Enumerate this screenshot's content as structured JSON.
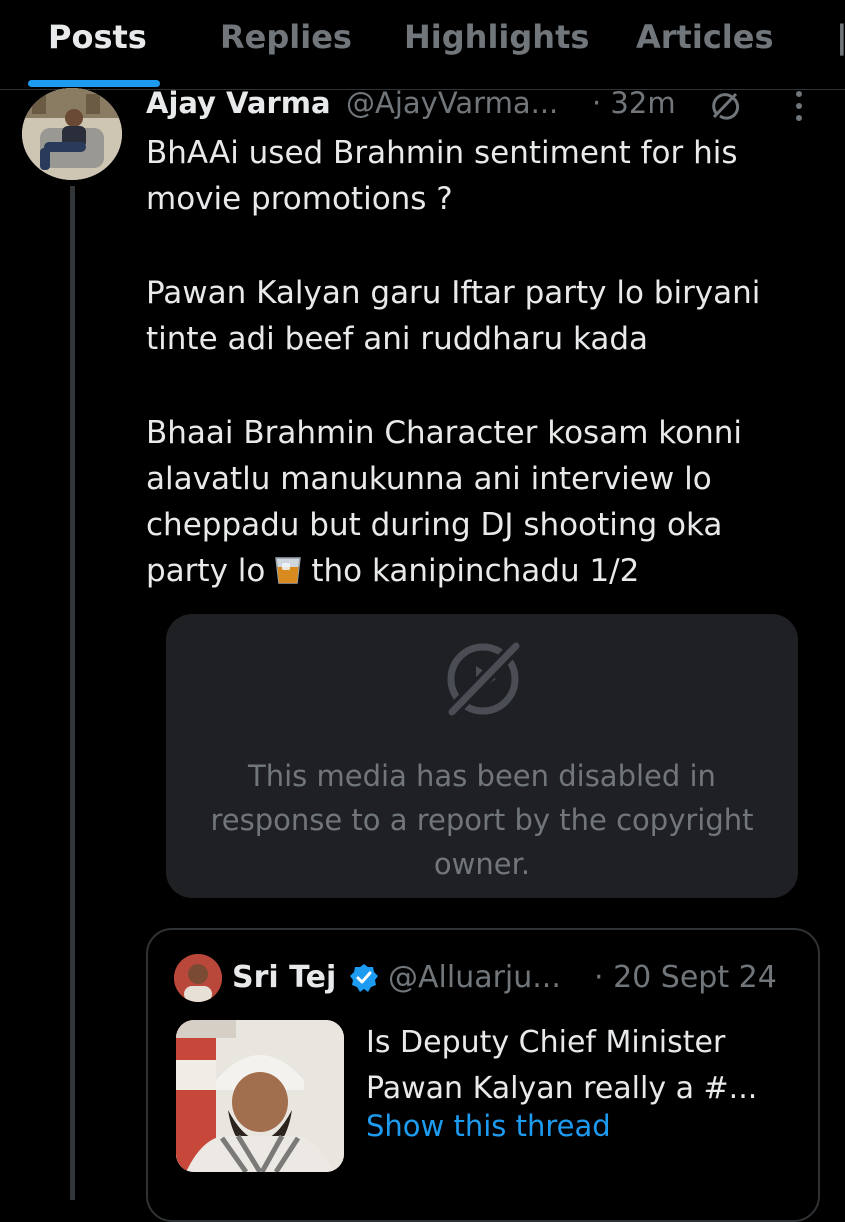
{
  "tabs": [
    {
      "label": "Posts",
      "active": true
    },
    {
      "label": "Replies",
      "active": false
    },
    {
      "label": "Highlights",
      "active": false
    },
    {
      "label": "Articles",
      "active": false
    }
  ],
  "colors": {
    "background": "#000000",
    "text_primary": "#e7e9ea",
    "text_secondary": "#71767b",
    "accent": "#1d9bf0",
    "card": "#1e2024",
    "border": "#2f3336"
  },
  "post": {
    "author_name": "Ajay Varma",
    "author_handle": "@AjayVarma...",
    "time": "· 32m",
    "icons": [
      "grok-icon",
      "more-icon"
    ],
    "lines": [
      "BhAAi used Brahmin sentiment for his",
      "movie promotions ?",
      "Pawan Kalyan garu Iftar party lo biryani",
      "tinte adi beef ani ruddharu kada",
      "Bhaai Brahmin Character kosam konni",
      "alavatlu manukunna ani interview lo",
      "cheppadu but during DJ shooting oka",
      "party lo",
      "tho kanipinchadu 1/2"
    ],
    "emoji_name": "tumbler-glass-icon"
  },
  "media_card": {
    "icon": "media-disabled-icon",
    "lines": [
      "This media has been disabled in",
      "response to a report by the copyright",
      "owner."
    ]
  },
  "quote": {
    "author_name": "Sri Tej",
    "verified": true,
    "author_handle": "@Alluarju...",
    "time": "· 20 Sept 24",
    "text_lines": [
      "Is Deputy Chief Minister",
      "Pawan Kalyan really a #..."
    ],
    "link": "Show this thread"
  }
}
